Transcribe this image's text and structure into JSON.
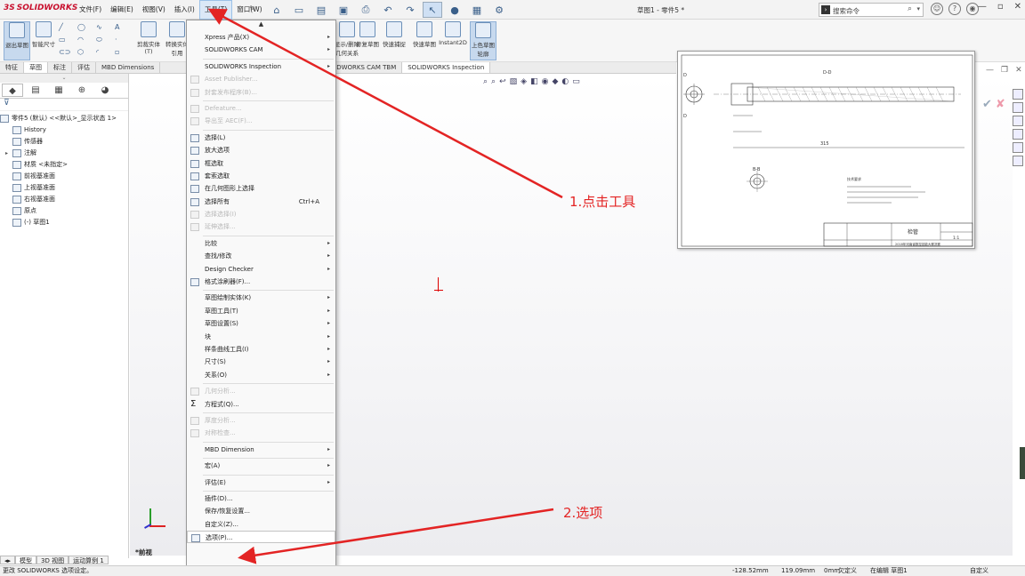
{
  "app": {
    "logo_ds": "3S",
    "logo_text": "SOLIDWORKS",
    "doc_title": "草图1 - 零件5 *"
  },
  "menubar": [
    "文件(F)",
    "编辑(E)",
    "视图(V)",
    "插入(I)",
    "工具(T)",
    "窗口(W)"
  ],
  "search": {
    "placeholder": "搜索命令"
  },
  "ribbon": {
    "exit_sketch": "退出草图",
    "smart_dim": "智能尺寸",
    "trim": "剪裁实体(T)",
    "convert": "转换实体引用",
    "display_relations": "显示/删除几何关系",
    "repair": "修复草图",
    "quick_snaps": "快速捕捉",
    "rapid_sketch": "快速草图",
    "instant2d": "Instant2D",
    "shaded_contours": "上色草图轮廓"
  },
  "tabs": [
    "特征",
    "草图",
    "标注",
    "评估",
    "MBD Dimensions",
    "SOLIDWORKS CAM TBM",
    "SOLIDWORKS Inspection"
  ],
  "tree": {
    "root": "零件5 (默认) <<默认>_显示状态 1>",
    "items": [
      "History",
      "传感器",
      "注解",
      "材质 <未指定>",
      "前视基准面",
      "上视基准面",
      "右视基准面",
      "原点",
      "(-) 草图1"
    ]
  },
  "bottom_tabs": [
    "模型",
    "3D 视图",
    "运动算例 1"
  ],
  "view_label": "*前视",
  "menu": {
    "items": [
      {
        "label": "Xpress 产品(X)",
        "arrow": true
      },
      {
        "label": "SOLIDWORKS CAM",
        "arrow": true
      },
      {
        "sep": true
      },
      {
        "label": "SOLIDWORKS Inspection",
        "arrow": true
      },
      {
        "label": "Asset Publisher...",
        "disabled": true,
        "icon": true
      },
      {
        "label": "封套发布程序(B)...",
        "disabled": true,
        "icon": true
      },
      {
        "sep": true
      },
      {
        "label": "Defeature...",
        "disabled": true,
        "icon": true
      },
      {
        "label": "导出至 AEC(F)...",
        "disabled": true,
        "icon": true
      },
      {
        "sep": true
      },
      {
        "label": "选择(L)",
        "icon": true
      },
      {
        "label": "放大选项",
        "icon": true
      },
      {
        "label": "框选取",
        "icon": true
      },
      {
        "label": "套索选取",
        "icon": true
      },
      {
        "label": "在几何图形上选择",
        "icon": true
      },
      {
        "label": "选择所有",
        "shortcut": "Ctrl+A",
        "icon": true
      },
      {
        "label": "选择选择(I)",
        "disabled": true,
        "icon": true
      },
      {
        "label": "延伸选择...",
        "disabled": true,
        "icon": true
      },
      {
        "sep": true
      },
      {
        "label": "比较",
        "arrow": true
      },
      {
        "label": "查找/修改",
        "arrow": true
      },
      {
        "label": "Design Checker",
        "arrow": true
      },
      {
        "label": "格式涂刷器(F)...",
        "icon": true
      },
      {
        "sep": true
      },
      {
        "label": "草图绘制实体(K)",
        "arrow": true
      },
      {
        "label": "草图工具(T)",
        "arrow": true
      },
      {
        "label": "草图设置(S)",
        "arrow": true
      },
      {
        "label": "块",
        "arrow": true
      },
      {
        "label": "样条曲线工具(I)",
        "arrow": true
      },
      {
        "label": "尺寸(S)",
        "arrow": true
      },
      {
        "label": "关系(O)",
        "arrow": true
      },
      {
        "sep": true
      },
      {
        "label": "几何分析...",
        "disabled": true,
        "icon": true
      },
      {
        "label": "方程式(Q)...",
        "sigma": true
      },
      {
        "sep": true
      },
      {
        "label": "厚度分析...",
        "disabled": true,
        "icon": true
      },
      {
        "label": "对称检查...",
        "disabled": true,
        "icon": true
      },
      {
        "sep": true
      },
      {
        "label": "MBD Dimension",
        "arrow": true
      },
      {
        "sep": true
      },
      {
        "label": "宏(A)",
        "arrow": true
      },
      {
        "sep": true
      },
      {
        "label": "评估(E)",
        "arrow": true
      },
      {
        "sep": true
      },
      {
        "label": "插件(D)..."
      },
      {
        "label": "保存/恢复设置..."
      },
      {
        "label": "自定义(Z)..."
      },
      {
        "label": "选项(P)...",
        "icon": true,
        "highlight": true
      }
    ]
  },
  "annotations": {
    "step1": "1.点击工具",
    "step2": "2.选项"
  },
  "drawing": {
    "sec_dd": "D-D",
    "sec_bb": "B-B",
    "dim_315": "315",
    "part_name": "检管",
    "scale": "1:1",
    "note_title": "技术要求",
    "footer": "2018年河南省数控技能大赛决赛"
  },
  "status": {
    "message": "更改 SOLIDWORKS 选项设定。",
    "x": "-128.52mm",
    "y": "119.09mm",
    "z": "0mm",
    "state": "欠定义",
    "editing": "在编辑 草图1",
    "custom": "自定义"
  }
}
